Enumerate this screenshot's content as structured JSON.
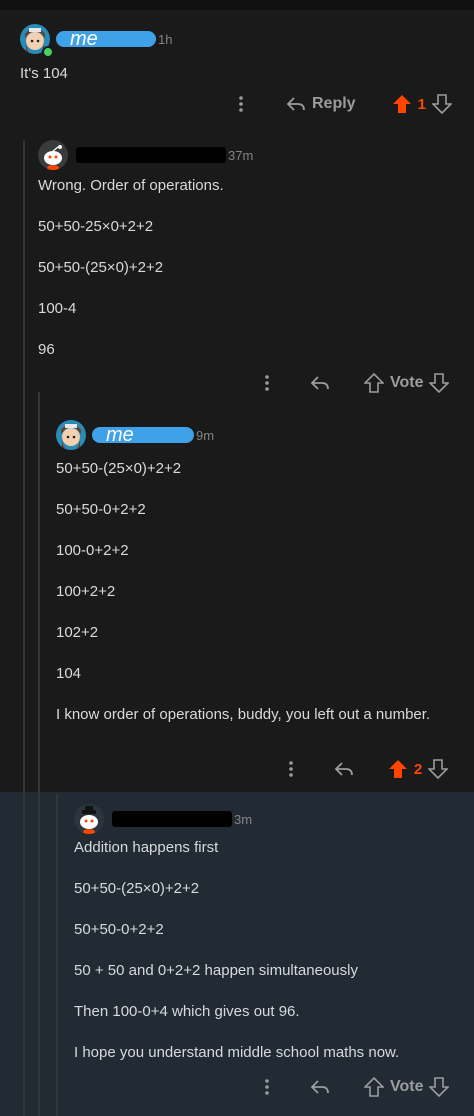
{
  "comments": [
    {
      "author_label": "me",
      "time": "1h",
      "body": [
        "It's 104"
      ],
      "actions": {
        "reply_label": "Reply",
        "vote_count": "1"
      }
    },
    {
      "author_label": "",
      "time": "37m",
      "body": [
        "Wrong. Order of operations.",
        "50+50-25×0+2+2",
        "50+50-(25×0)+2+2",
        "100-4",
        "96"
      ],
      "actions": {
        "vote_label": "Vote"
      }
    },
    {
      "author_label": "me",
      "time": "9m",
      "body": [
        "50+50-(25×0)+2+2",
        "50+50-0+2+2",
        "100-0+2+2",
        "100+2+2",
        "102+2",
        "104",
        "I know order of operations, buddy, you left out a number."
      ],
      "actions": {
        "vote_count": "2"
      }
    },
    {
      "author_label": "",
      "time": "3m",
      "body": [
        "Addition happens first",
        "50+50-(25×0)+2+2",
        "50+50-0+2+2",
        "50 + 50 and 0+2+2 happen simultaneously",
        "Then 100-0+4 which gives out 96.",
        "I hope you understand middle school maths now."
      ],
      "actions": {
        "vote_label": "Vote"
      }
    }
  ],
  "colors": {
    "upvote_active": "#ff4500",
    "background": "#1a1a1b",
    "highlight": "#222a33",
    "redaction_blue": "#3fa2e8"
  }
}
